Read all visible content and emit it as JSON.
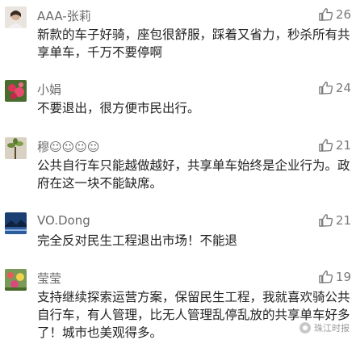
{
  "comments": [
    {
      "name": "AAA-张莉",
      "likes": "26",
      "text": "新款的车子好骑，座包很舒服，踩着又省力，秒杀所有共享单车，千万不要停啊",
      "avatar": "user-avatar-photo"
    },
    {
      "name": "小娟",
      "likes": "24",
      "text": "不要退出，很方便市民出行。",
      "avatar": "flower-avatar"
    },
    {
      "name": "穆☺☺☺☺",
      "likes": "21",
      "text": "公共自行车只能越做越好，共享单车始终是企业行为。政府在这一块不能缺席。",
      "avatar": "plant-avatar"
    },
    {
      "name": "VO.Dong",
      "likes": "21",
      "text": "完全反对民生工程退出市场！不能退",
      "avatar": "landscape-avatar"
    },
    {
      "name": "莹莹",
      "likes": "19",
      "text": "支持继续探索运营方案，保留民生工程，我就喜欢骑公共自行车，有人管理，比无人管理乱停乱放的共享单车好多了！城市也美观得多。",
      "avatar": "garden-avatar"
    }
  ],
  "watermark": "珠江时报",
  "colors": {
    "like_icon": "#7a7a7a",
    "name": "#6a6a6a",
    "text": "#222222"
  }
}
